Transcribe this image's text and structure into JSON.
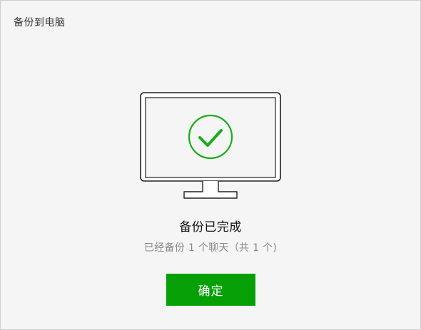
{
  "window": {
    "title": "备份到电脑"
  },
  "status": {
    "heading": "备份已完成",
    "detail": "已经备份 1 个聊天（共 1 个)",
    "icon": "check-circle-icon",
    "accent_color": "#1aad19"
  },
  "actions": {
    "confirm_label": "确定",
    "confirm_color": "#06a006"
  }
}
